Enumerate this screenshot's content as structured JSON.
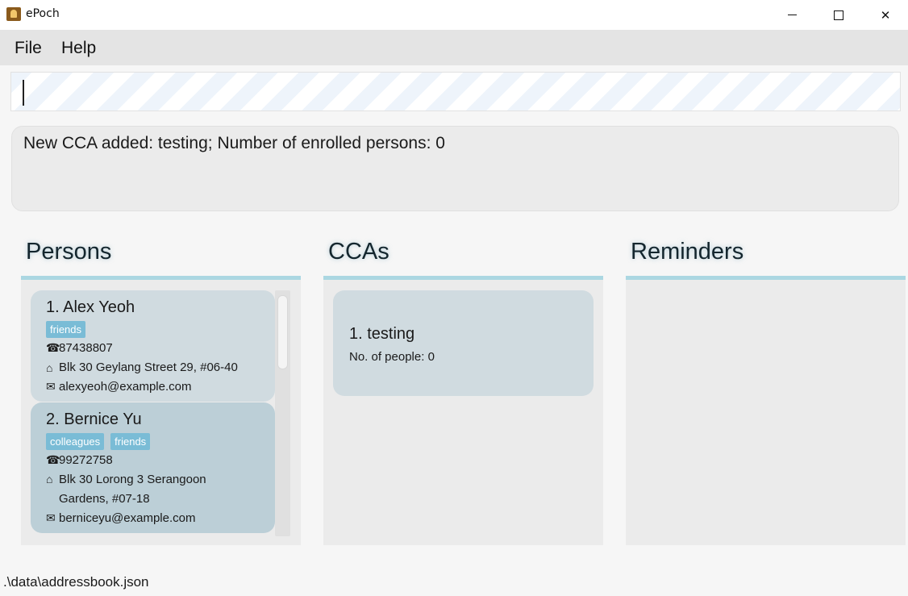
{
  "window": {
    "title": "ePoch",
    "minimize": "—",
    "maximize": "☐",
    "close": "✕"
  },
  "menu": {
    "file": "File",
    "help": "Help"
  },
  "command": {
    "value": "",
    "placeholder": ""
  },
  "result": {
    "text": "New CCA added: testing; Number of enrolled persons: 0"
  },
  "panels": {
    "persons": "Persons",
    "ccas": "CCAs",
    "reminders": "Reminders"
  },
  "persons": [
    {
      "name": "1.  Alex Yeoh",
      "tags": [
        "friends"
      ],
      "phone": "87438807",
      "address": "Blk 30 Geylang Street 29, #06-40",
      "email": "alexyeoh@example.com"
    },
    {
      "name": "2.  Bernice Yu",
      "tags": [
        "colleagues",
        "friends"
      ],
      "phone": "99272758",
      "address": "Blk 30 Lorong 3 Serangoon Gardens, #07-18",
      "email": "berniceyu@example.com"
    }
  ],
  "ccas": [
    {
      "name": "1.  testing",
      "count": "No. of people: 0"
    }
  ],
  "status": {
    "path": ".\\data\\addressbook.json"
  },
  "colors": {
    "accent": "#abd7e2",
    "tag": "#7abcd6",
    "card": "#d0dbe0",
    "card_selected": "#bccfd7"
  },
  "icons": {
    "phone": "phone-icon",
    "address": "home-icon",
    "email": "email-icon"
  }
}
